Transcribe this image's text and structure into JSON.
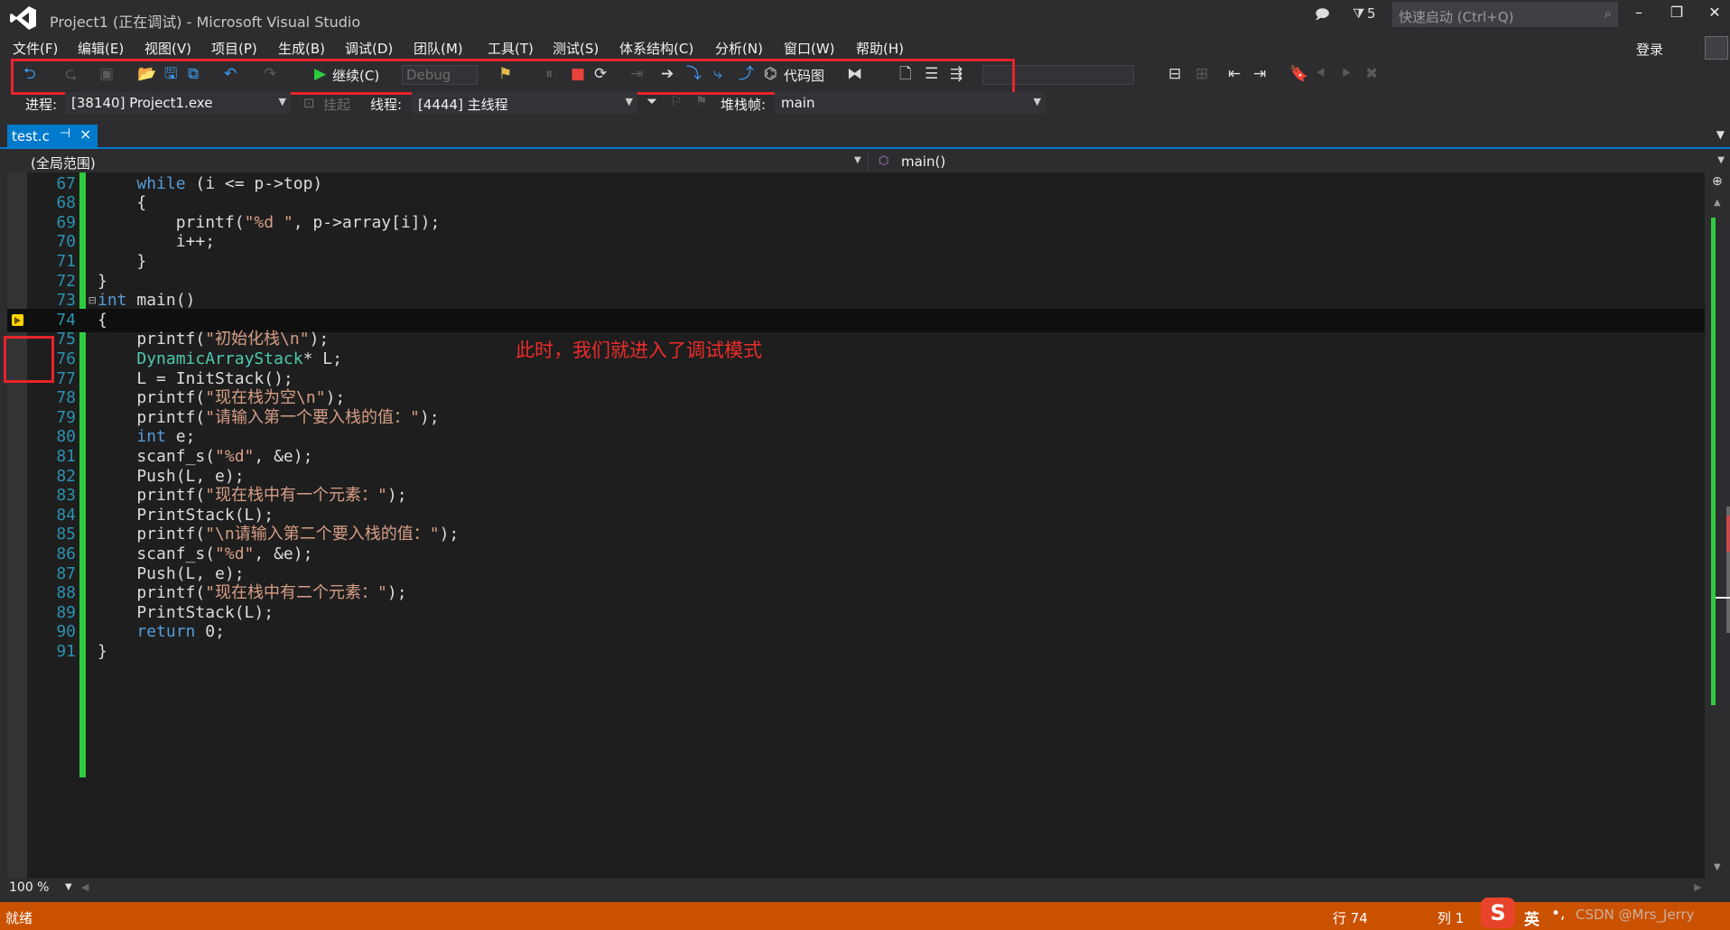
{
  "window": {
    "title": "Project1 (正在调试) - Microsoft Visual Studio",
    "notifications_count": "5",
    "quick_launch_placeholder": "快速启动 (Ctrl+Q)",
    "login_label": "登录"
  },
  "menu": [
    "文件(F)",
    "编辑(E)",
    "视图(V)",
    "项目(P)",
    "生成(B)",
    "调试(D)",
    "团队(M)",
    "工具(T)",
    "测试(S)",
    "体系结构(C)",
    "分析(N)",
    "窗口(W)",
    "帮助(H)"
  ],
  "toolbar": {
    "continue_label": "继续(C)",
    "config_value": "Debug",
    "code_map_label": "代码图"
  },
  "debug_location": {
    "process_label": "进程:",
    "process_value": "[38140] Project1.exe",
    "suspend_label": "挂起",
    "thread_label": "线程:",
    "thread_value": "[4444] 主线程",
    "stackframe_label": "堆栈帧:",
    "stackframe_value": "main"
  },
  "tab": {
    "name": "test.c"
  },
  "navigation": {
    "scope": "(全局范围)",
    "function": "main()"
  },
  "code_lines": [
    {
      "n": "67",
      "text": "    while (i <= p->top)"
    },
    {
      "n": "68",
      "text": "    {"
    },
    {
      "n": "69",
      "text": "        printf(\"%d \", p->array[i]);"
    },
    {
      "n": "70",
      "text": "        i++;"
    },
    {
      "n": "71",
      "text": "    }"
    },
    {
      "n": "72",
      "text": "}"
    },
    {
      "n": "73",
      "text": "int main()"
    },
    {
      "n": "74",
      "text": "{"
    },
    {
      "n": "75",
      "text": "    printf(\"初始化栈\\n\");"
    },
    {
      "n": "76",
      "text": "    DynamicArrayStack* L;"
    },
    {
      "n": "77",
      "text": "    L = InitStack();"
    },
    {
      "n": "78",
      "text": "    printf(\"现在栈为空\\n\");"
    },
    {
      "n": "79",
      "text": "    printf(\"请输入第一个要入栈的值：\");"
    },
    {
      "n": "80",
      "text": "    int e;"
    },
    {
      "n": "81",
      "text": "    scanf_s(\"%d\", &e);"
    },
    {
      "n": "82",
      "text": "    Push(L, e);"
    },
    {
      "n": "83",
      "text": "    printf(\"现在栈中有一个元素：\");"
    },
    {
      "n": "84",
      "text": "    PrintStack(L);"
    },
    {
      "n": "85",
      "text": "    printf(\"\\n请输入第二个要入栈的值：\");"
    },
    {
      "n": "86",
      "text": "    scanf_s(\"%d\", &e);"
    },
    {
      "n": "87",
      "text": "    Push(L, e);"
    },
    {
      "n": "88",
      "text": "    printf(\"现在栈中有二个元素：\");"
    },
    {
      "n": "89",
      "text": "    PrintStack(L);"
    },
    {
      "n": "90",
      "text": "    return 0;"
    },
    {
      "n": "91",
      "text": "}"
    }
  ],
  "annotation": "此时，我们就进入了调试模式",
  "zoom": "100 %",
  "status": {
    "ready": "就绪",
    "line": "行 74",
    "col": "列 1"
  },
  "ime": {
    "lang": "英"
  },
  "watermark": "CSDN @Mrs_Jerry",
  "colors": {
    "statusbar": "#ca5100",
    "accent": "#007acc",
    "highlight_box": "#e8242b"
  }
}
